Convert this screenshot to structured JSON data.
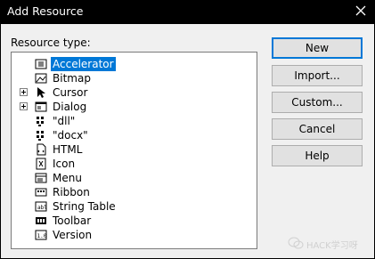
{
  "window": {
    "title": "Add Resource"
  },
  "list": {
    "label": "Resource type:",
    "items": [
      {
        "label": "Accelerator",
        "icon": "accelerator-icon",
        "expandable": false,
        "selected": true
      },
      {
        "label": "Bitmap",
        "icon": "bitmap-icon",
        "expandable": false,
        "selected": false
      },
      {
        "label": "Cursor",
        "icon": "cursor-icon",
        "expandable": true,
        "selected": false
      },
      {
        "label": "Dialog",
        "icon": "dialog-icon",
        "expandable": true,
        "selected": false
      },
      {
        "label": "\"dll\"",
        "icon": "custom-resource-icon",
        "expandable": false,
        "selected": false
      },
      {
        "label": "\"docx\"",
        "icon": "custom-resource-icon",
        "expandable": false,
        "selected": false
      },
      {
        "label": "HTML",
        "icon": "html-icon",
        "expandable": false,
        "selected": false
      },
      {
        "label": "Icon",
        "icon": "icon-resource-icon",
        "expandable": false,
        "selected": false
      },
      {
        "label": "Menu",
        "icon": "menu-icon",
        "expandable": false,
        "selected": false
      },
      {
        "label": "Ribbon",
        "icon": "ribbon-icon",
        "expandable": false,
        "selected": false
      },
      {
        "label": "String Table",
        "icon": "string-table-icon",
        "expandable": false,
        "selected": false
      },
      {
        "label": "Toolbar",
        "icon": "toolbar-icon",
        "expandable": false,
        "selected": false
      },
      {
        "label": "Version",
        "icon": "version-icon",
        "expandable": false,
        "selected": false
      }
    ]
  },
  "buttons": {
    "new": "New",
    "import": "Import...",
    "custom": "Custom...",
    "cancel": "Cancel",
    "help": "Help"
  },
  "watermark": {
    "text": "HACK学习呀",
    "icon": "wechat-icon"
  },
  "colors": {
    "selection": "#0078d7",
    "titlebar": "#000000"
  }
}
